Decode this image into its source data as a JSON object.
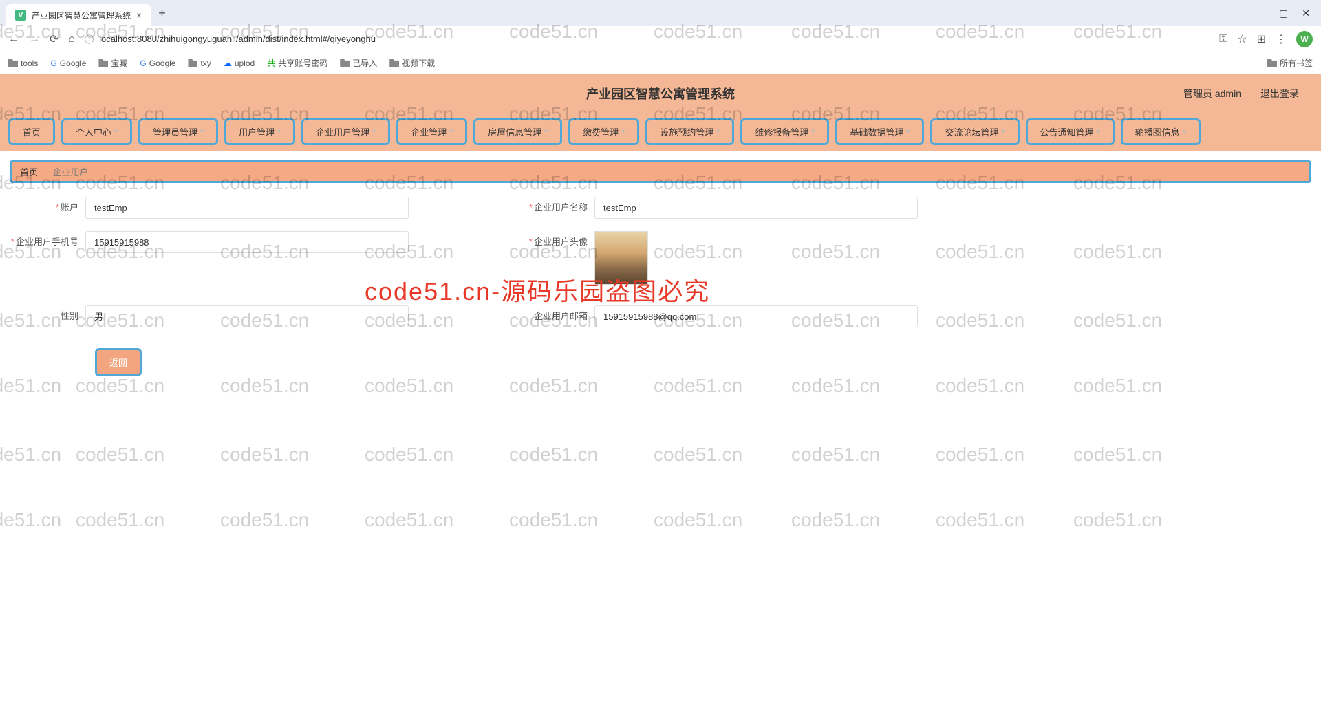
{
  "browser": {
    "tab_title": "产业园区智慧公寓管理系统",
    "url": "localhost:8080/zhihuigongyuguanli/admin/dist/index.html#/qiyeyonghu",
    "avatar_letter": "W",
    "bookmarks": [
      "tools",
      "Google",
      "宝藏",
      "Google",
      "txy",
      "uplod",
      "共享账号密码",
      "已导入",
      "视频下载"
    ],
    "all_bookmarks": "所有书签"
  },
  "header": {
    "title": "产业园区智慧公寓管理系统",
    "admin_label": "管理员 admin",
    "logout": "退出登录"
  },
  "nav": [
    {
      "label": "首页",
      "dropdown": false
    },
    {
      "label": "个人中心",
      "dropdown": true
    },
    {
      "label": "管理员管理",
      "dropdown": true
    },
    {
      "label": "用户管理",
      "dropdown": true
    },
    {
      "label": "企业用户管理",
      "dropdown": true
    },
    {
      "label": "企业管理",
      "dropdown": true
    },
    {
      "label": "房屋信息管理",
      "dropdown": true
    },
    {
      "label": "缴费管理",
      "dropdown": true
    },
    {
      "label": "设施预约管理",
      "dropdown": true
    },
    {
      "label": "维修报备管理",
      "dropdown": true
    },
    {
      "label": "基础数据管理",
      "dropdown": true
    },
    {
      "label": "交流论坛管理",
      "dropdown": true
    },
    {
      "label": "公告通知管理",
      "dropdown": true
    },
    {
      "label": "轮播图信息",
      "dropdown": true
    }
  ],
  "breadcrumb": {
    "home": "首页",
    "current": "企业用户"
  },
  "form": {
    "account": {
      "label": "账户",
      "value": "testEmp",
      "required": true
    },
    "name": {
      "label": "企业用户名称",
      "value": "testEmp",
      "required": true
    },
    "phone": {
      "label": "企业用户手机号",
      "value": "15915915988",
      "required": true
    },
    "avatar": {
      "label": "企业用户头像",
      "required": true
    },
    "gender": {
      "label": "性别",
      "value": "男",
      "required": false
    },
    "email": {
      "label": "企业用户邮箱",
      "value": "15915915988@qq.com",
      "required": false
    },
    "back_btn": "返回"
  },
  "watermark": {
    "text": "code51.cn",
    "red_text": "code51.cn-源码乐园盗图必究"
  }
}
